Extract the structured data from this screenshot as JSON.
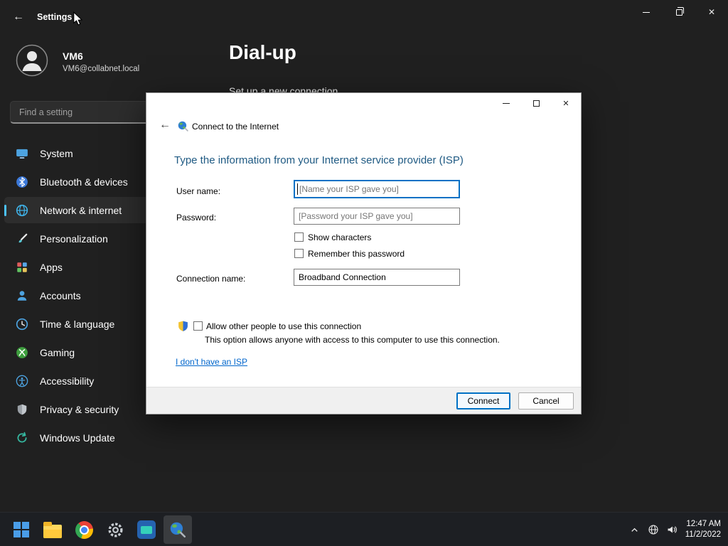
{
  "icons": {
    "back_arrow": "←",
    "close": "✕"
  },
  "settings": {
    "titlebar": {
      "title": "Settings"
    },
    "profile": {
      "name": "VM6",
      "email": "VM6@collabnet.local"
    },
    "search": {
      "placeholder": "Find a setting"
    },
    "sidebar": [
      {
        "label": "System"
      },
      {
        "label": "Bluetooth & devices"
      },
      {
        "label": "Network & internet"
      },
      {
        "label": "Personalization"
      },
      {
        "label": "Apps"
      },
      {
        "label": "Accounts"
      },
      {
        "label": "Time & language"
      },
      {
        "label": "Gaming"
      },
      {
        "label": "Accessibility"
      },
      {
        "label": "Privacy & security"
      },
      {
        "label": "Windows Update"
      }
    ],
    "page": {
      "title": "Dial-up",
      "setup_link": "Set up a new connection"
    }
  },
  "dialog": {
    "title": "Connect to the Internet",
    "heading": "Type the information from your Internet service provider (ISP)",
    "username": {
      "label": "User name:",
      "placeholder": "[Name your ISP gave you]"
    },
    "password": {
      "label": "Password:",
      "placeholder": "[Password your ISP gave you]"
    },
    "show_characters": "Show characters",
    "remember_password": "Remember this password",
    "connection": {
      "label": "Connection name:",
      "value": "Broadband Connection"
    },
    "allow": {
      "label": "Allow other people to use this connection",
      "description": "This option allows anyone with access to this computer to use this connection."
    },
    "no_isp_link": "I don't have an ISP",
    "buttons": {
      "connect": "Connect",
      "cancel": "Cancel"
    }
  },
  "taskbar": {
    "clock": {
      "time": "12:47 AM",
      "date": "11/2/2022"
    }
  },
  "colors": {
    "accent": "#0078d4",
    "dialog_heading": "#1f5a83",
    "link": "#0066cc",
    "selected_pill": "#4cc2ff"
  }
}
